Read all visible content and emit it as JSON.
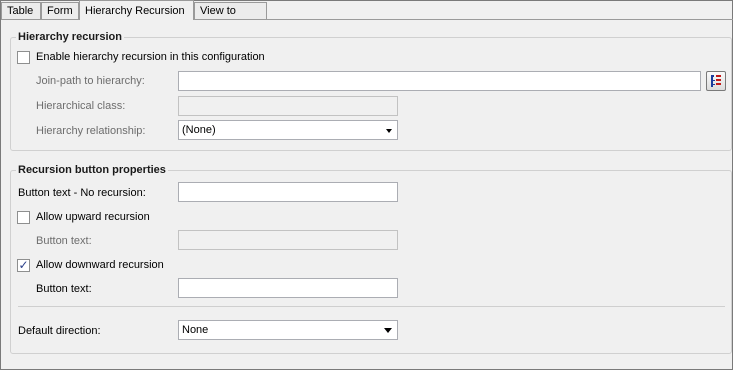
{
  "tabs": [
    "Table",
    "Form",
    "Hierarchy Recursion",
    "View to Open"
  ],
  "hierarchy_group": {
    "title": "Hierarchy recursion",
    "enable_label": "Enable hierarchy recursion in this configuration",
    "enable_checked": false,
    "join_path_label": "Join-path to hierarchy:",
    "join_path_value": "",
    "hier_class_label": "Hierarchical class:",
    "hier_class_value": "",
    "relationship_label": "Hierarchy relationship:",
    "relationship_value": "(None)",
    "join_path_button_icon": "hierarchy-tree-icon"
  },
  "recursion_group": {
    "title": "Recursion button properties",
    "no_recursion_label": "Button text - No recursion:",
    "no_recursion_value": "",
    "upward_label": "Allow upward recursion",
    "upward_checked": false,
    "upward_button_text_label": "Button text:",
    "upward_button_text_value": "",
    "downward_label": "Allow downward recursion",
    "downward_checked": true,
    "downward_button_text_label": "Button text:",
    "downward_button_text_value": "",
    "default_direction_label": "Default direction:",
    "default_direction_value": "None"
  }
}
